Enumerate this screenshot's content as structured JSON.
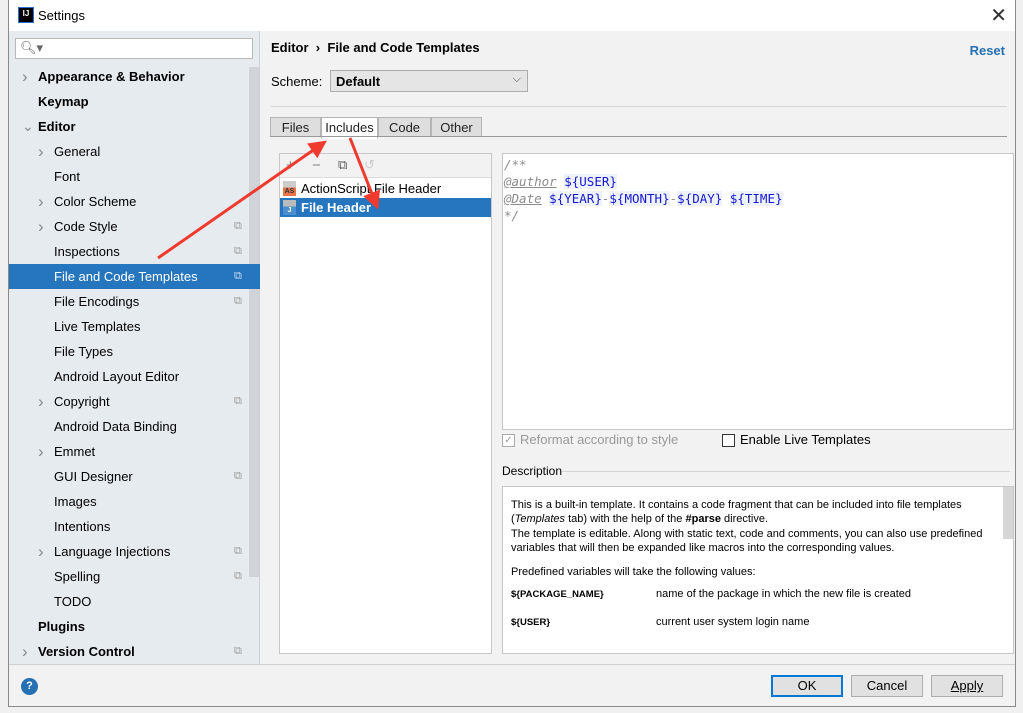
{
  "window": {
    "title": "Settings",
    "logo": "IJ",
    "close_icon": "close-icon"
  },
  "sidebar": {
    "search_placeholder": "",
    "items": [
      {
        "label": "Appearance & Behavior",
        "level": 0,
        "bold": true,
        "arrow": "right"
      },
      {
        "label": "Keymap",
        "level": 0,
        "bold": true,
        "arrow": ""
      },
      {
        "label": "Editor",
        "level": 0,
        "bold": true,
        "arrow": "down"
      },
      {
        "label": "General",
        "level": 1,
        "arrow": "right"
      },
      {
        "label": "Font",
        "level": 1,
        "arrow": ""
      },
      {
        "label": "Color Scheme",
        "level": 1,
        "arrow": "right"
      },
      {
        "label": "Code Style",
        "level": 1,
        "arrow": "right",
        "project": true
      },
      {
        "label": "Inspections",
        "level": 1,
        "arrow": "",
        "project": true
      },
      {
        "label": "File and Code Templates",
        "level": 1,
        "arrow": "",
        "project": true,
        "selected": true
      },
      {
        "label": "File Encodings",
        "level": 1,
        "arrow": "",
        "project": true
      },
      {
        "label": "Live Templates",
        "level": 1,
        "arrow": ""
      },
      {
        "label": "File Types",
        "level": 1,
        "arrow": ""
      },
      {
        "label": "Android Layout Editor",
        "level": 1,
        "arrow": ""
      },
      {
        "label": "Copyright",
        "level": 1,
        "arrow": "right",
        "project": true
      },
      {
        "label": "Android Data Binding",
        "level": 1,
        "arrow": ""
      },
      {
        "label": "Emmet",
        "level": 1,
        "arrow": "right"
      },
      {
        "label": "GUI Designer",
        "level": 1,
        "arrow": "",
        "project": true
      },
      {
        "label": "Images",
        "level": 1,
        "arrow": ""
      },
      {
        "label": "Intentions",
        "level": 1,
        "arrow": ""
      },
      {
        "label": "Language Injections",
        "level": 1,
        "arrow": "right",
        "project": true
      },
      {
        "label": "Spelling",
        "level": 1,
        "arrow": "",
        "project": true
      },
      {
        "label": "TODO",
        "level": 1,
        "arrow": ""
      },
      {
        "label": "Plugins",
        "level": 0,
        "bold": true,
        "arrow": ""
      },
      {
        "label": "Version Control",
        "level": 0,
        "bold": true,
        "arrow": "right",
        "project": true
      }
    ]
  },
  "main": {
    "breadcrumb": [
      "Editor",
      "File and Code Templates"
    ],
    "breadcrumb_sep": "›",
    "reset": "Reset",
    "scheme_label": "Scheme:",
    "scheme_value": "Default",
    "tabs": [
      {
        "label": "Files"
      },
      {
        "label": "Includes",
        "active": true
      },
      {
        "label": "Code"
      },
      {
        "label": "Other"
      }
    ],
    "list": [
      {
        "label": "ActionScript File Header",
        "icon": "AS"
      },
      {
        "label": "File Header",
        "icon": "J",
        "selected": true
      }
    ],
    "editor_lines": {
      "l1": "/**",
      "author_tag": "@author",
      "user_var": "${USER}",
      "date_tag": "@Date",
      "year": "${YEAR}",
      "month": "${MONTH}",
      "day": "${DAY}",
      "time": "${TIME}",
      "dash": "-",
      "l4": "*/"
    },
    "reformat_label": "Reformat according to style",
    "reformat_checked": true,
    "reformat_disabled": true,
    "live_label": "Enable Live Templates",
    "live_checked": false,
    "description_label": "Description",
    "description": {
      "p1a": "This is a built-in template. It contains a code fragment that can be included into file templates (",
      "p1i": "Templates",
      "p1b": " tab) with the help of the ",
      "p1bold": "#parse",
      "p1c": " directive.",
      "p2": "The template is editable. Along with static text, code and comments, you can also use predefined variables that will then be expanded like macros into the corresponding values.",
      "p3": "Predefined variables will take the following values:",
      "vars": [
        {
          "name": "${PACKAGE_NAME}",
          "desc": "name of the package in which the new file is created"
        },
        {
          "name": "${USER}",
          "desc": "current user system login name"
        }
      ]
    }
  },
  "buttons": {
    "ok": "OK",
    "cancel": "Cancel",
    "apply": "Apply",
    "help": "?"
  },
  "colors": {
    "accent": "#2675bf",
    "annotation_arrow": "#f03a2e",
    "link": "#2470b3"
  }
}
